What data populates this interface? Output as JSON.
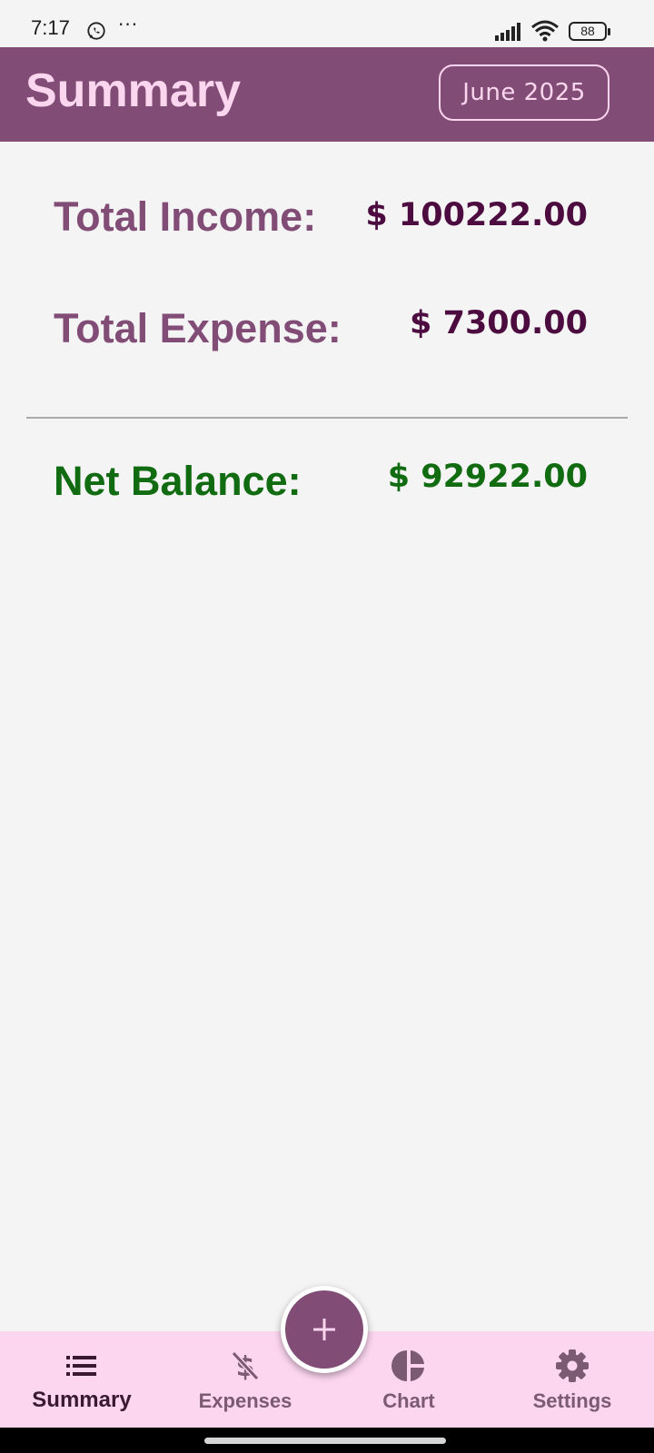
{
  "status_bar": {
    "time": "7:17",
    "dots": "···",
    "battery": "88"
  },
  "header": {
    "title": "Summary",
    "month_button": "June 2025"
  },
  "summary": {
    "income_label": "Total Income:",
    "income_value": "$ 100222.00",
    "expense_label": "Total Expense:",
    "expense_value": "$ 7300.00",
    "net_label": "Net Balance:",
    "net_value": "$ 92922.00"
  },
  "bottom_nav": {
    "items": [
      {
        "label": "Summary",
        "icon": "list-icon",
        "active": true
      },
      {
        "label": "Expenses",
        "icon": "money-off-icon",
        "active": false
      },
      {
        "label": "Chart",
        "icon": "pie-chart-icon",
        "active": false
      },
      {
        "label": "Settings",
        "icon": "gear-icon",
        "active": false
      }
    ]
  },
  "fab": {
    "icon": "plus-icon"
  },
  "colors": {
    "primary": "#814c75",
    "on_primary": "#fcd5ef",
    "value_text": "#4d0c3f",
    "net_positive": "#116b11",
    "nav_background": "#fcd5ef",
    "page_background": "#f4f4f4"
  }
}
